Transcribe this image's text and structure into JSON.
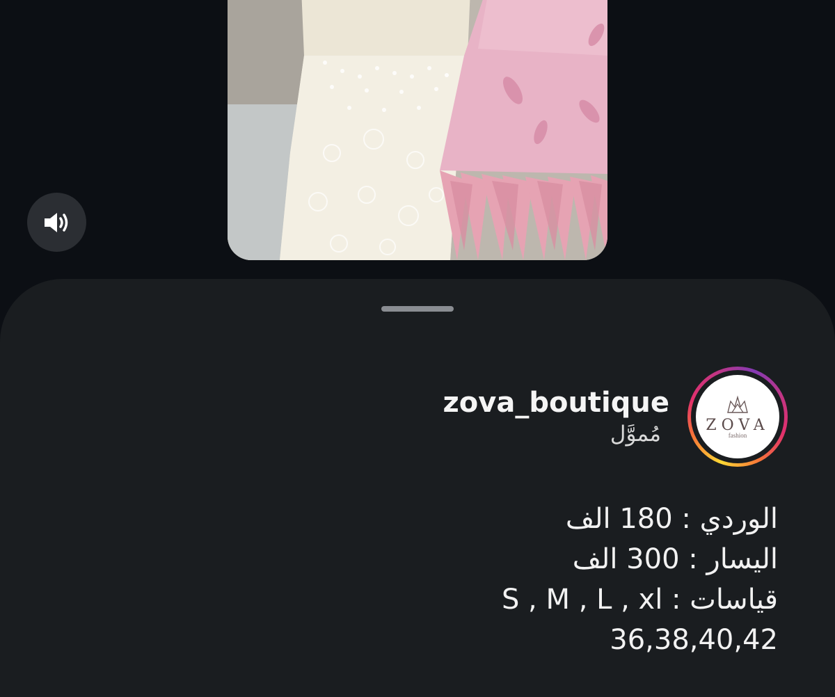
{
  "media": {
    "description_icon": "video-preview",
    "colors": {
      "left_dress": "#ece6d6",
      "right_dress": "#e8b3c6",
      "background": "#c9c4bb"
    }
  },
  "sound": {
    "icon": "speaker-on-icon",
    "state": "on"
  },
  "sheet": {
    "author": {
      "username": "zova_boutique",
      "label": "مُموَّل",
      "avatar": {
        "logo_text": "ZOVA",
        "logo_sub": "fashion"
      }
    },
    "caption": {
      "lines": [
        "الوردي : 180 الف",
        "اليسار : 300 الف",
        "قياسات : S , M , L , xl",
        "36,38,40,42"
      ]
    }
  }
}
